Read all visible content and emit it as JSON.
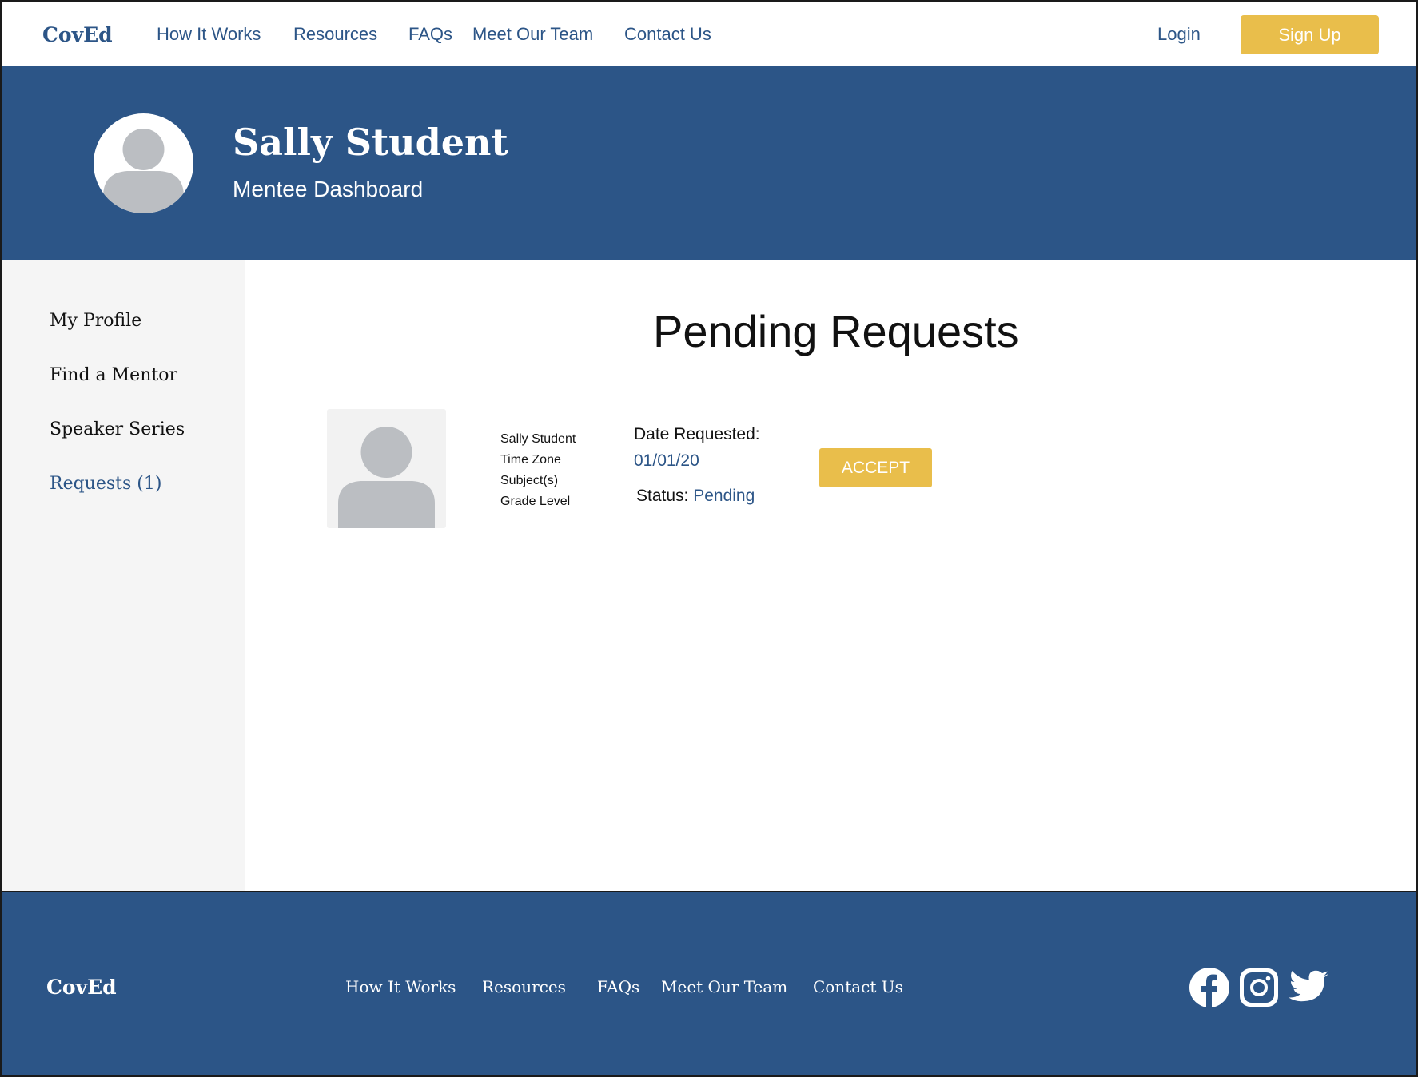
{
  "nav": {
    "logo": "CovEd",
    "links": [
      "How It Works",
      "Resources",
      "FAQs",
      "Meet Our Team",
      "Contact Us"
    ],
    "login": "Login",
    "signup": "Sign Up"
  },
  "banner": {
    "name": "Sally Student",
    "role": "Mentee Dashboard"
  },
  "sidebar": {
    "items": [
      {
        "label": "My Profile"
      },
      {
        "label": "Find a Mentor"
      },
      {
        "label": "Speaker Series"
      },
      {
        "label": "Requests (1)"
      }
    ]
  },
  "main": {
    "title": "Pending Requests",
    "request": {
      "name": "Sally Student",
      "time_zone": "Time Zone",
      "subjects": "Subject(s)",
      "grade_level": "Grade Level",
      "date_label": "Date Requested:",
      "date_value": "01/01/20",
      "status_label": "Status:",
      "status_value": "Pending",
      "accept_label": "ACCEPT"
    }
  },
  "footer": {
    "logo": "CovEd",
    "links": [
      "How It Works",
      "Resources",
      "FAQs",
      "Meet Our Team",
      "Contact Us"
    ],
    "social": [
      "facebook-icon",
      "instagram-icon",
      "twitter-icon"
    ]
  },
  "colors": {
    "primary": "#2c5587",
    "accent": "#e9be4b",
    "sidebar_bg": "#f5f5f5",
    "avatar_gray": "#bbbec2"
  }
}
